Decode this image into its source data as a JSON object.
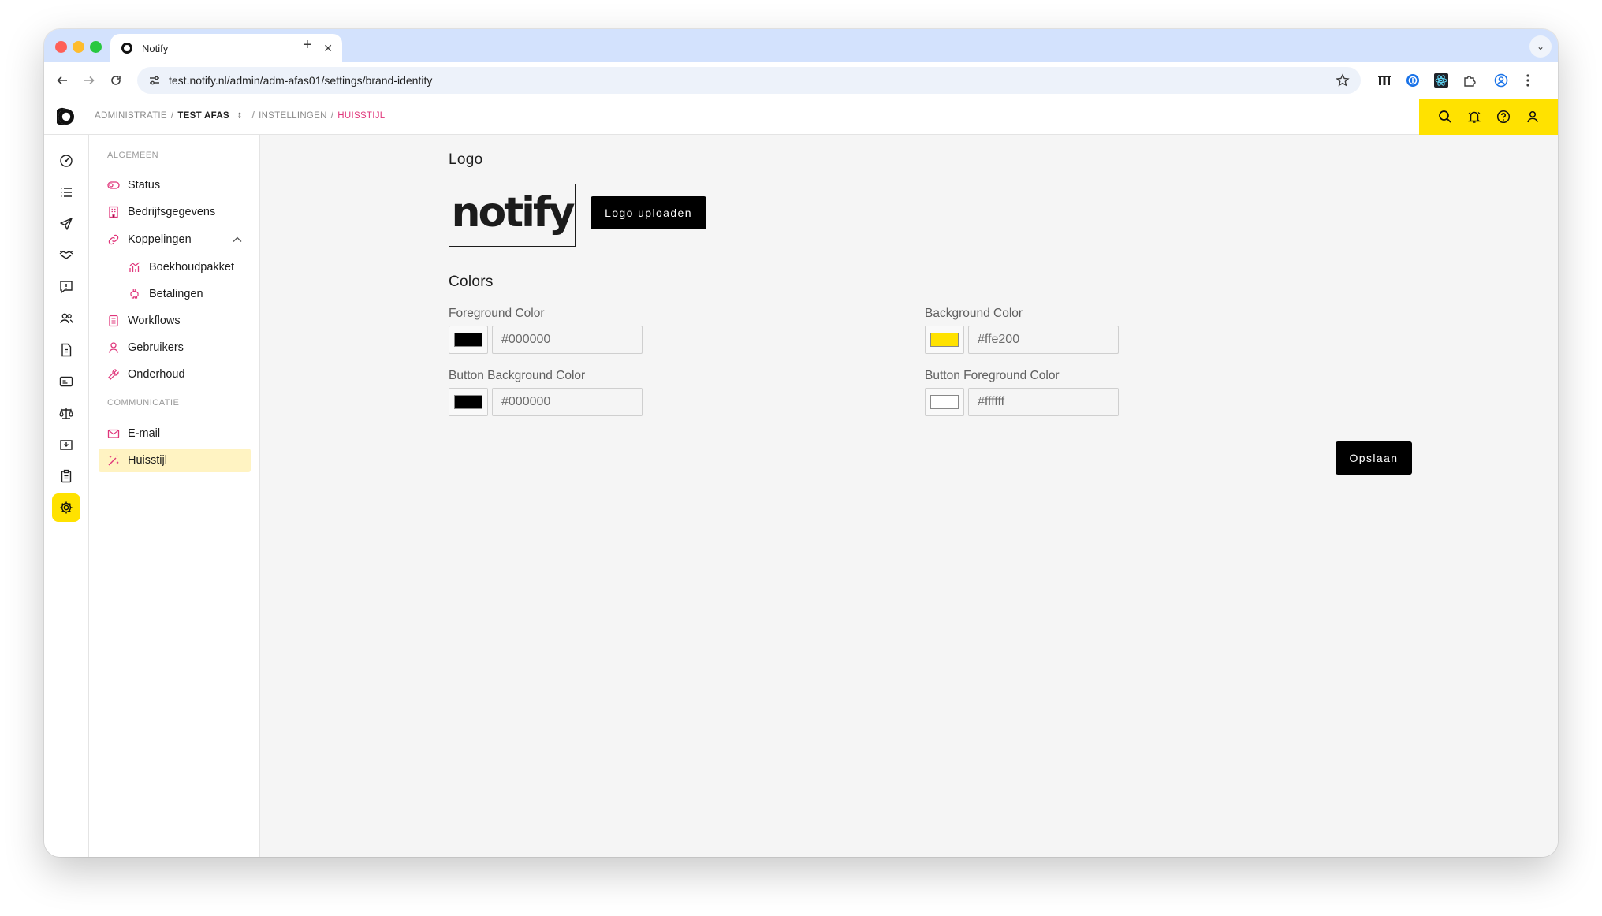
{
  "browser": {
    "tab_title": "Notify",
    "url": "test.notify.nl/admin/adm-afas01/settings/brand-identity"
  },
  "breadcrumb": {
    "root": "ADMINISTRATIE",
    "org": "TEST AFAS",
    "section": "INSTELLINGEN",
    "current": "HUISSTIJL"
  },
  "header_actions": [
    "search-icon",
    "bell-icon",
    "help-icon",
    "user-icon"
  ],
  "rail_icons": [
    "dashboard-icon",
    "list-icon",
    "send-icon",
    "handshake-icon",
    "message-icon",
    "users-icon",
    "document-icon",
    "card-icon",
    "scale-icon",
    "inbox-icon",
    "clipboard-icon",
    "settings-icon"
  ],
  "sidebar": {
    "section_general": "ALGEMEEN",
    "section_communication": "COMMUNICATIE",
    "items": [
      {
        "label": "Status",
        "icon": "toggle-icon"
      },
      {
        "label": "Bedrijfsgegevens",
        "icon": "building-icon"
      },
      {
        "label": "Koppelingen",
        "icon": "link-icon"
      },
      {
        "label": "Boekhoudpakket",
        "icon": "chart-icon"
      },
      {
        "label": "Betalingen",
        "icon": "piggybank-icon"
      },
      {
        "label": "Workflows",
        "icon": "workflow-icon"
      },
      {
        "label": "Gebruikers",
        "icon": "user-icon"
      },
      {
        "label": "Onderhoud",
        "icon": "wrench-icon"
      },
      {
        "label": "E-mail",
        "icon": "mail-icon"
      },
      {
        "label": "Huisstijl",
        "icon": "wand-icon"
      }
    ]
  },
  "logo_section": {
    "heading": "Logo",
    "logo_text": "notify",
    "upload_button": "Logo uploaden"
  },
  "colors_section": {
    "heading": "Colors",
    "foreground": {
      "label": "Foreground Color",
      "value": "#000000",
      "swatch": "#000000"
    },
    "background": {
      "label": "Background Color",
      "value": "#ffe200",
      "swatch": "#ffe200"
    },
    "button_background": {
      "label": "Button Background Color",
      "value": "#000000",
      "swatch": "#000000"
    },
    "button_foreground": {
      "label": "Button Foreground Color",
      "value": "#ffffff",
      "swatch": "#ffffff"
    }
  },
  "save_button": "Opslaan",
  "colors": {
    "accent": "#ffe200",
    "pink": "#e0367b",
    "dark": "#000000"
  }
}
